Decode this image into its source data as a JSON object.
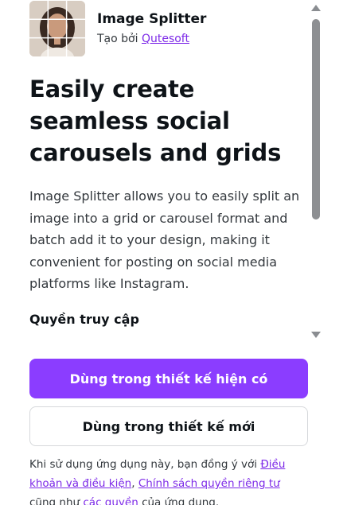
{
  "app": {
    "name": "Image Splitter",
    "byline_prefix": "Tạo bởi",
    "author": "Qutesoft"
  },
  "headline": "Easily create seamless social carousels and grids",
  "description": "Image Splitter allows you to easily split an image into a grid or carousel format and batch add it to your design, making it convenient for posting on social media platforms like Instagram.",
  "permissions_heading": "Quyền truy cập",
  "actions": {
    "use_existing": "Dùng trong thiết kế hiện có",
    "use_new": "Dùng trong thiết kế mới"
  },
  "terms": {
    "prefix": "Khi sử dụng ứng dụng này, bạn đồng ý với",
    "tos_link": "Điều khoản và điều kiện",
    "sep": ",",
    "privacy_link": "Chính sách quyền riêng tư",
    "middle": "cũng như",
    "permissions_link": "các quyền",
    "suffix": "của ứng dụng."
  },
  "colors": {
    "primary": "#8b3dff",
    "link": "#7d2ae8"
  }
}
